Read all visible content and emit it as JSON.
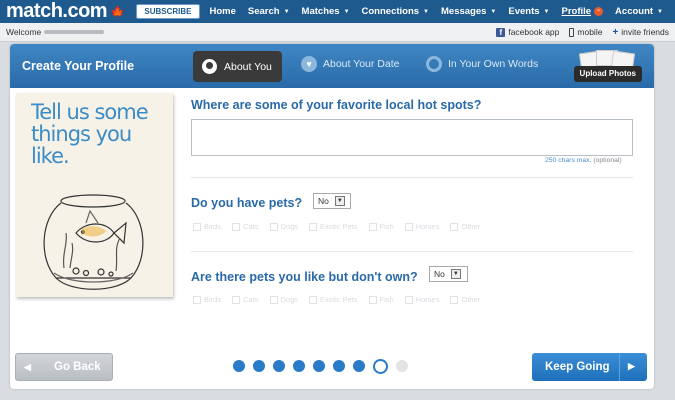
{
  "topnav": {
    "logo": "match.com",
    "subscribe": "SUBSCRIBE",
    "items": [
      {
        "label": "Home",
        "caret": false
      },
      {
        "label": "Search",
        "caret": true
      },
      {
        "label": "Matches",
        "caret": true
      },
      {
        "label": "Connections",
        "caret": true
      },
      {
        "label": "Messages",
        "caret": true
      },
      {
        "label": "Events",
        "caret": true
      },
      {
        "label": "Profile",
        "caret": false
      },
      {
        "label": "Account",
        "caret": true
      }
    ]
  },
  "welcome": {
    "label": "Welcome",
    "links": [
      "facebook app",
      "mobile",
      "invite friends"
    ]
  },
  "header": {
    "title": "Create Your Profile",
    "tabs": [
      "About You",
      "About Your Date",
      "In Your Own Words"
    ],
    "upload_photos": "Upload Photos"
  },
  "card": {
    "text": "Tell us some things you like."
  },
  "form": {
    "q1": "Where are some of your favorite local hot spots?",
    "char_hint": "250 chars max.",
    "char_optional": "(optional)",
    "q2": "Do you have pets?",
    "q2_value": "No",
    "q3": "Are there pets you like but don't own?",
    "q3_value": "No",
    "pets": [
      "Birds",
      "Cats",
      "Dogs",
      "Exotic Pets",
      "Fish",
      "Horses",
      "Other"
    ]
  },
  "footer": {
    "go_back": "Go Back",
    "keep_going": "Keep Going",
    "steps_total": 9,
    "steps_completed": 7,
    "steps_current": 8
  },
  "colors": {
    "brand": "#1f5a8f",
    "accent": "#2a6aa8",
    "button_primary": "#1f6fba"
  }
}
